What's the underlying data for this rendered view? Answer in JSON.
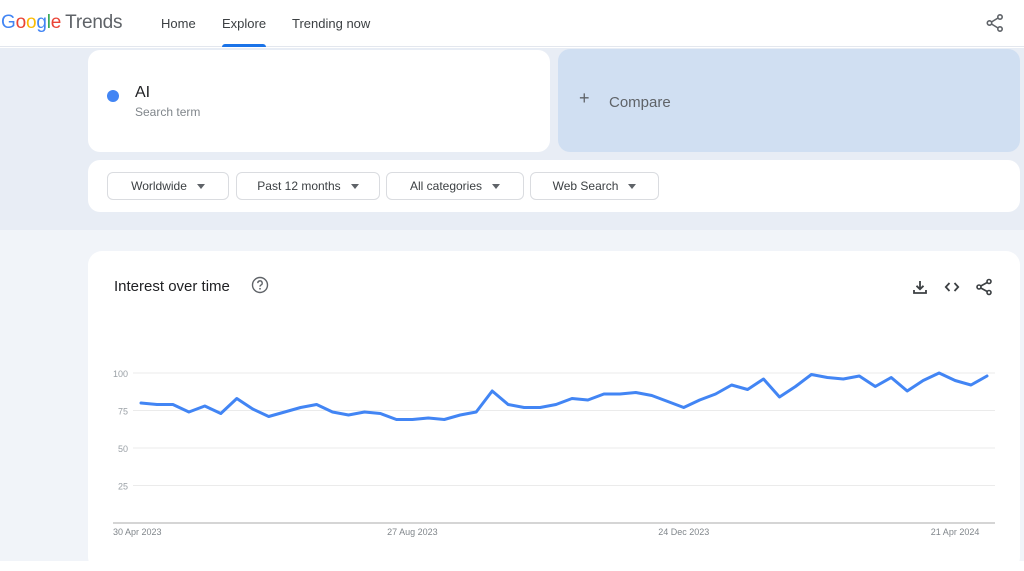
{
  "header": {
    "logo_letters": [
      "G",
      "o",
      "o",
      "g",
      "l",
      "e"
    ],
    "logo_product": "Trends",
    "nav": [
      {
        "label": "Home",
        "active": false
      },
      {
        "label": "Explore",
        "active": true
      },
      {
        "label": "Trending now",
        "active": false
      }
    ],
    "share_icon": "share-icon"
  },
  "search": {
    "term": "AI",
    "term_type": "Search term",
    "term_color": "#4285f4",
    "compare_label": "Compare",
    "compare_icon": "plus-icon"
  },
  "filters": [
    {
      "label": "Worldwide"
    },
    {
      "label": "Past 12 months"
    },
    {
      "label": "All categories"
    },
    {
      "label": "Web Search"
    }
  ],
  "panel": {
    "title": "Interest over time",
    "help_icon": "help-circle-icon",
    "actions": [
      "download-icon",
      "embed-code-icon",
      "share-icon"
    ]
  },
  "chart_data": {
    "type": "line",
    "title": "Interest over time",
    "xlabel": "",
    "ylabel": "",
    "ylim": [
      0,
      100
    ],
    "yticks": [
      25,
      50,
      75,
      100
    ],
    "grid": true,
    "x_tick_labels": [
      {
        "label": "30 Apr 2023",
        "index": 0
      },
      {
        "label": "27 Aug 2023",
        "index": 17
      },
      {
        "label": "24 Dec 2023",
        "index": 34
      },
      {
        "label": "21 Apr 2024",
        "index": 51
      }
    ],
    "x_start": "30 Apr 2023",
    "x_interval": "weekly",
    "series": [
      {
        "name": "AI",
        "color": "#4285f4",
        "values": [
          80,
          79,
          79,
          74,
          78,
          73,
          83,
          76,
          71,
          74,
          77,
          79,
          74,
          72,
          74,
          73,
          69,
          69,
          70,
          69,
          72,
          74,
          88,
          79,
          77,
          77,
          79,
          83,
          82,
          86,
          86,
          87,
          85,
          81,
          77,
          82,
          86,
          92,
          89,
          96,
          84,
          91,
          99,
          97,
          96,
          98,
          91,
          97,
          88,
          95,
          100,
          95,
          92,
          98
        ]
      }
    ]
  }
}
